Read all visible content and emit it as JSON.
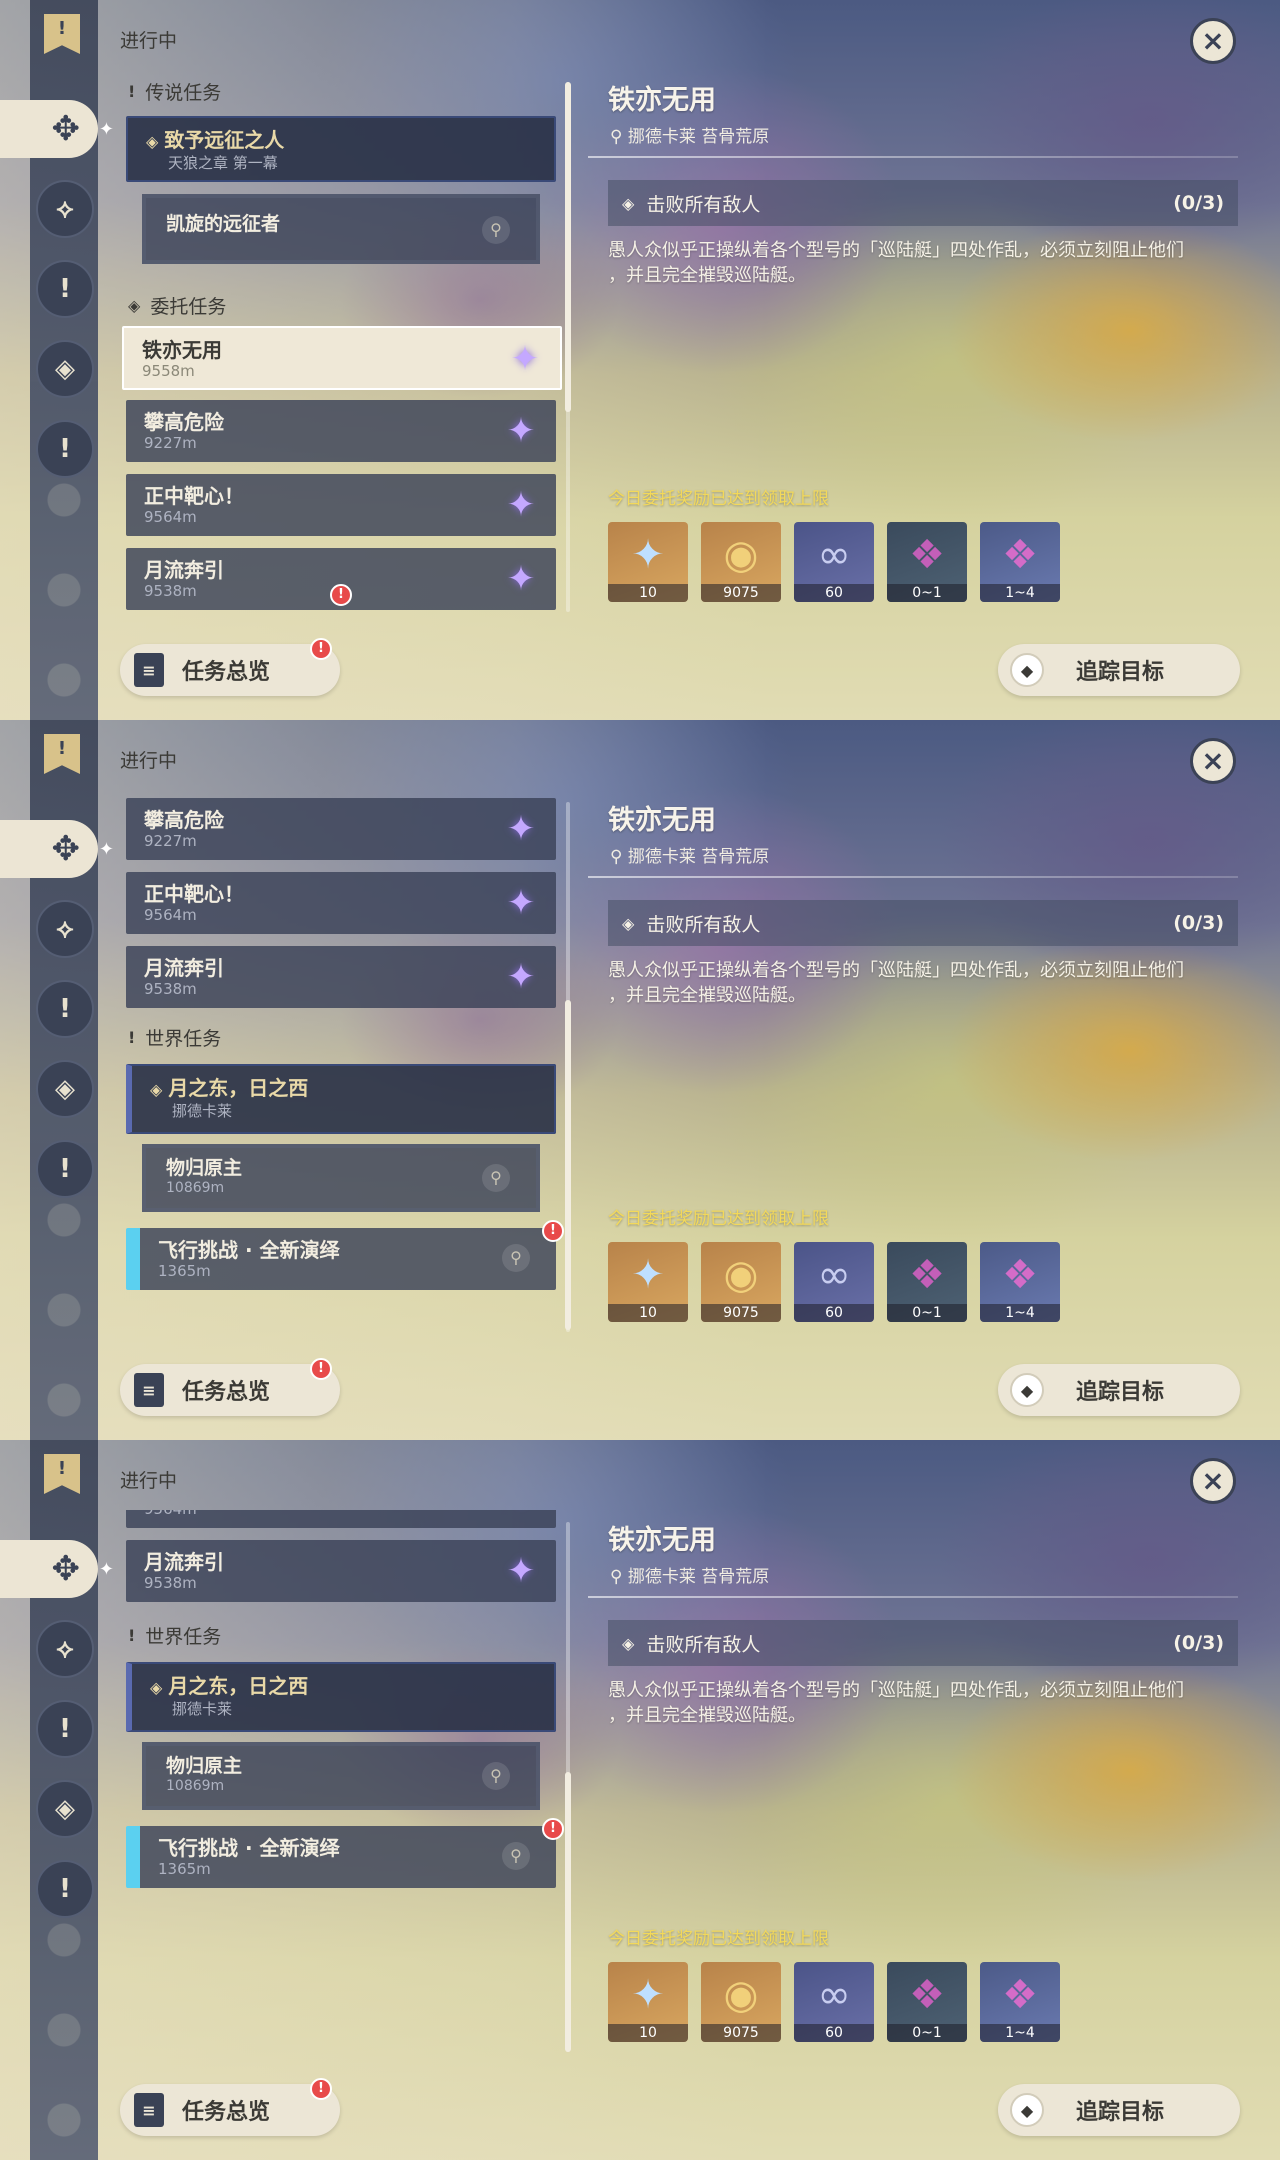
{
  "common": {
    "status_label": "进行中",
    "quest_title": "铁亦无用",
    "quest_location": "挪德卡莱 苔骨荒原",
    "objective_text": "击败所有敌人",
    "objective_count": "(0/3)",
    "description_line1": "愚人众似乎正操纵着各个型号的「巡陆艇」四处作乱，必须立刻阻止他们",
    "description_line2": "，并且完全摧毁巡陆艇。",
    "reward_limit_text": "今日委托奖励已达到领取上限",
    "rewards": [
      {
        "name": "primogem",
        "qty": "10",
        "icon": "✦"
      },
      {
        "name": "mora",
        "qty": "9075",
        "icon": "◉"
      },
      {
        "name": "companionship-exp",
        "qty": "60",
        "icon": "∞"
      },
      {
        "name": "crystal",
        "qty": "0~1",
        "icon": "❖"
      },
      {
        "name": "crystal-cluster",
        "qty": "1~4",
        "icon": "❖"
      }
    ],
    "overview_button": "任务总览",
    "track_button": "追踪目标",
    "close_icon": "×"
  },
  "sections": {
    "legend": "传说任务",
    "commission": "委托任务",
    "world": "世界任务"
  },
  "quests": {
    "legend_main_title": "致予远征之人",
    "legend_main_sub": "天狼之章 第一幕",
    "legend_step": "凯旋的远征者",
    "c1_title": "铁亦无用",
    "c1_dist": "9558m",
    "c2_title": "攀高危险",
    "c2_dist": "9227m",
    "c3_title": "正中靶心！",
    "c3_dist": "9564m",
    "c4_title": "月流奔引",
    "c4_dist": "9538m",
    "world_main_title": "月之东，日之西",
    "world_main_sub": "挪德卡莱",
    "world_step_title": "物归原主",
    "world_step_dist": "10869m",
    "flight_title": "飞行挑战 · 全新演绎",
    "flight_dist": "1365m"
  },
  "colors": {
    "accent_gold": "#f3d95a",
    "alert_red": "#e84a4a",
    "card_dark": "#3a4258",
    "card_selected": "#efe8d7",
    "flight_marker": "#5bd0f0"
  }
}
